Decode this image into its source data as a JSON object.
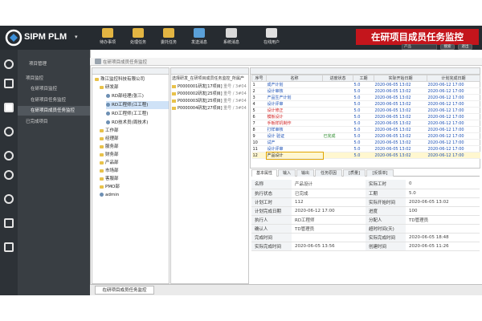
{
  "app": {
    "logo_text": "SIPM PLM",
    "banner": "在研项目成员任务监控"
  },
  "toolbar": [
    {
      "label": "待办事项",
      "icon": "todo-icon",
      "color": "#e3b542"
    },
    {
      "label": "处理任务",
      "icon": "task-icon",
      "color": "#e3b542"
    },
    {
      "label": "委托任务",
      "icon": "delegate-icon",
      "color": "#e3b542"
    },
    {
      "label": "发送消息",
      "icon": "send-message-icon",
      "color": "#5aa0d8"
    },
    {
      "label": "系统消息",
      "icon": "system-message-icon",
      "color": "#d9d9d9"
    },
    {
      "label": "在线用户",
      "icon": "online-users-icon",
      "color": "#e0e0e0"
    }
  ],
  "header_right": {
    "user_select": "产品",
    "search_label": "搜索",
    "exit_label": "退出"
  },
  "nav": {
    "items": [
      {
        "label": "项目管理",
        "selected": false
      },
      {
        "label": "项目监控",
        "selected": false
      },
      {
        "label": "在研项目监控",
        "selected": false
      },
      {
        "label": "在研项目任务监控",
        "selected": false
      },
      {
        "label": "在研项目成员任务监控",
        "selected": true
      },
      {
        "label": "已完成项目",
        "selected": false
      }
    ]
  },
  "breadcrumb": "在研项目成员任务监控",
  "org_tree": {
    "root": "珠江监控科技有限公司",
    "items": [
      {
        "label": "研发部",
        "level": 1
      },
      {
        "label": "RD部经理(张三)",
        "level": 2
      },
      {
        "label": "RD工程师(江工程)",
        "level": 2,
        "selected": true
      },
      {
        "label": "RD工程师(工工程)",
        "level": 2
      },
      {
        "label": "RD技术员(周技术)",
        "level": 2
      },
      {
        "label": "工作部",
        "level": 1
      },
      {
        "label": "经理部",
        "level": 1
      },
      {
        "label": "服务部",
        "level": 1
      },
      {
        "label": "财务部",
        "level": 1
      },
      {
        "label": "产品部",
        "level": 1
      },
      {
        "label": "市场部",
        "level": 1
      },
      {
        "label": "客服部",
        "level": 1
      },
      {
        "label": "PMO部",
        "level": 1
      },
      {
        "label": "admin",
        "level": 1
      }
    ]
  },
  "projects": {
    "header": "选择研发_在研项目成员任务监控_所属产",
    "items": [
      {
        "code": "P0000001",
        "name": "研发[17项目]",
        "tail": "重号 / 3#04"
      },
      {
        "code": "P0000002",
        "name": "研发[25项目]",
        "tail": "重号 / 3#04"
      },
      {
        "code": "P0000003",
        "name": "研发[25项目]",
        "tail": "重号 / 3#04"
      },
      {
        "code": "P0000004",
        "name": "研发[27项目]",
        "tail": "重号 / 3#04"
      }
    ]
  },
  "tasks": {
    "columns": [
      "序号",
      "名称",
      "进度状态",
      "工期",
      "实际开始日期",
      "计划完成日期"
    ],
    "rows": [
      {
        "no": "1",
        "name": "成产计划",
        "status": "",
        "days": "5.0",
        "start": "2020-06-05 13:02",
        "finish": "2020-06-12 17:00",
        "style": "blue"
      },
      {
        "no": "2",
        "name": "设计审核",
        "status": "",
        "days": "5.0",
        "start": "2020-06-05 13:02",
        "finish": "2020-06-12 17:00",
        "style": "blue"
      },
      {
        "no": "3",
        "name": "产品生产计划",
        "status": "",
        "days": "5.0",
        "start": "2020-06-05 13:02",
        "finish": "2020-06-12 17:00",
        "style": "blue"
      },
      {
        "no": "4",
        "name": "设计评审",
        "status": "",
        "days": "5.0",
        "start": "2020-06-05 13:02",
        "finish": "2020-06-12 17:00",
        "style": "blue"
      },
      {
        "no": "5",
        "name": "设计修正",
        "status": "",
        "days": "5.0",
        "start": "2020-06-05 13:02",
        "finish": "2020-06-12 17:00",
        "style": "red"
      },
      {
        "no": "6",
        "name": "模板设计",
        "status": "",
        "days": "5.0",
        "start": "2020-06-05 13:02",
        "finish": "2020-06-12 17:00",
        "style": "red"
      },
      {
        "no": "7",
        "name": "手板样机制作",
        "status": "",
        "days": "5.0",
        "start": "2020-06-05 13:02",
        "finish": "2020-06-12 17:00",
        "style": "red"
      },
      {
        "no": "8",
        "name": "打样审核",
        "status": "",
        "days": "5.0",
        "start": "2020-06-05 13:02",
        "finish": "2020-06-12 17:00",
        "style": "blue"
      },
      {
        "no": "9",
        "name": "设计 验证",
        "status": "已完成",
        "days": "5.0",
        "start": "2020-06-05 13:02",
        "finish": "2020-06-12 17:00",
        "style": "blue"
      },
      {
        "no": "10",
        "name": "试产",
        "status": "",
        "days": "5.0",
        "start": "2020-06-05 13:02",
        "finish": "2020-06-12 17:00",
        "style": "blue"
      },
      {
        "no": "11",
        "name": "设计评审",
        "status": "",
        "days": "5.0",
        "start": "2020-06-05 13:02",
        "finish": "2020-06-12 17:00",
        "style": "blue"
      },
      {
        "no": "12",
        "name": "产品设计",
        "status": "",
        "days": "5.0",
        "start": "2020-06-05 13:02",
        "finish": "2020-06-12 17:00",
        "style": "sel"
      }
    ]
  },
  "detail_tabs": [
    "基本属性",
    "输入",
    "输出",
    "任务原因",
    "[质量]",
    "[反馈单]"
  ],
  "detail": [
    {
      "l1": "名称",
      "v1": "产品设计",
      "l2": "实际工时",
      "v2": "0"
    },
    {
      "l1": "执行状态",
      "v1": "已完成",
      "l2": "工期",
      "v2": "5.0"
    },
    {
      "l1": "计划工时",
      "v1": "112",
      "l2": "实际开始时间",
      "v2": "2020-06-05 13:02"
    },
    {
      "l1": "计划完成日期",
      "v1": "2020-06-12 17:00",
      "l2": "进度",
      "v2": "100"
    },
    {
      "l1": "执行人",
      "v1": "RD工程师",
      "l2": "分配人",
      "v2": "TD管理员"
    },
    {
      "l1": "确认人",
      "v1": "TD管理员",
      "l2": "超时时间(天)",
      "v2": ""
    },
    {
      "l1": "完成时间",
      "v1": "",
      "l2": "实际完成时间",
      "v2": "2020-06-05 18:48"
    },
    {
      "l1": "实际完成时间",
      "v1": "2020-06-05 13:56",
      "l2": "创建时间",
      "v2": "2020-06-05 11:26"
    }
  ],
  "bottom_tab": "在研项目成员任务监控"
}
